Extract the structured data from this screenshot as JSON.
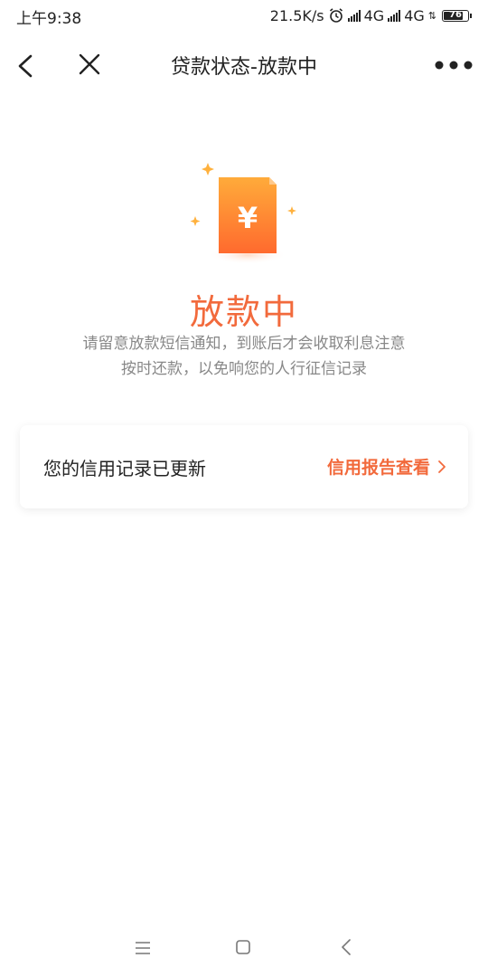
{
  "status_bar": {
    "time": "上午9:38",
    "net_speed": "21.5K/s",
    "network_1": "4G",
    "network_2": "4G",
    "battery_level": "76",
    "icons": [
      "alarm-icon",
      "signal-icon",
      "signal-icon",
      "charging-icon",
      "battery-icon"
    ]
  },
  "nav": {
    "title": "贷款状态-放款中",
    "icons": [
      "back-icon",
      "close-icon",
      "more-icon"
    ]
  },
  "hero": {
    "icon_symbol": "¥",
    "status_title": "放款中",
    "description_line1": "请留意放款短信通知，到账后才会收取利息注意",
    "description_line2": "按时还款，以免响您的人行征信记录"
  },
  "credit": {
    "text": "您的信用记录已更新",
    "link_label": "信用报告查看"
  },
  "system_nav": {
    "icons": [
      "menu-icon",
      "home-icon",
      "back-icon"
    ]
  },
  "colors": {
    "accent": "#f26a3c",
    "icon_gradient_top": "#ffab3a",
    "icon_gradient_bottom": "#ff6a2e",
    "text_primary": "#222222",
    "text_secondary": "#888888"
  }
}
